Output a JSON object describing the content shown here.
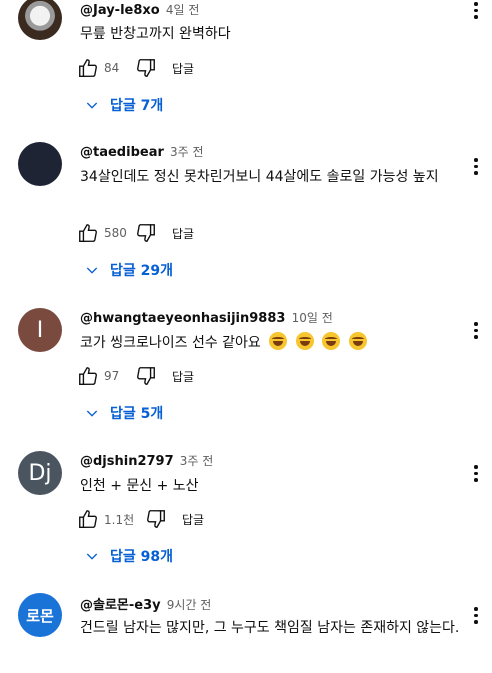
{
  "comments": [
    {
      "handle": "@Jay-le8xo",
      "time": "4일 전",
      "text": "무릎 반창고까지 완벽하다",
      "likes": "84",
      "reply_label": "답글",
      "replies": "답글 7개",
      "avatar": "eagle-avatar"
    },
    {
      "handle": "@taedibear",
      "time": "3주 전",
      "text": "34살인데도 정신 못차린거보니 44살에도 솔로일 가능성 높지",
      "likes": "580",
      "reply_label": "답글",
      "replies": "답글 29개",
      "avatar": "dark-avatar"
    },
    {
      "handle": "@hwangtaeyeonhasijin9883",
      "time": "10일 전",
      "text": "코가 씽크로나이즈 선수 같아요",
      "likes": "97",
      "reply_label": "답글",
      "replies": "답글 5개",
      "avatar_letter": "I"
    },
    {
      "handle": "@djshin2797",
      "time": "3주 전",
      "text": "인천 + 문신 + 노산",
      "likes": "1.1천",
      "reply_label": "답글",
      "replies": "답글 98개",
      "avatar_letter": "Dj"
    },
    {
      "handle": "@솔로몬-e3y",
      "time": "9시간 전",
      "text": "건드릴 남자는 많지만, 그 누구도 책임질 남자는 존재하지 않는다.",
      "avatar_letter": "로몬"
    }
  ],
  "colors": {
    "link_blue": "#065fd4",
    "text_primary": "#0f0f0f",
    "text_secondary": "#606060"
  }
}
